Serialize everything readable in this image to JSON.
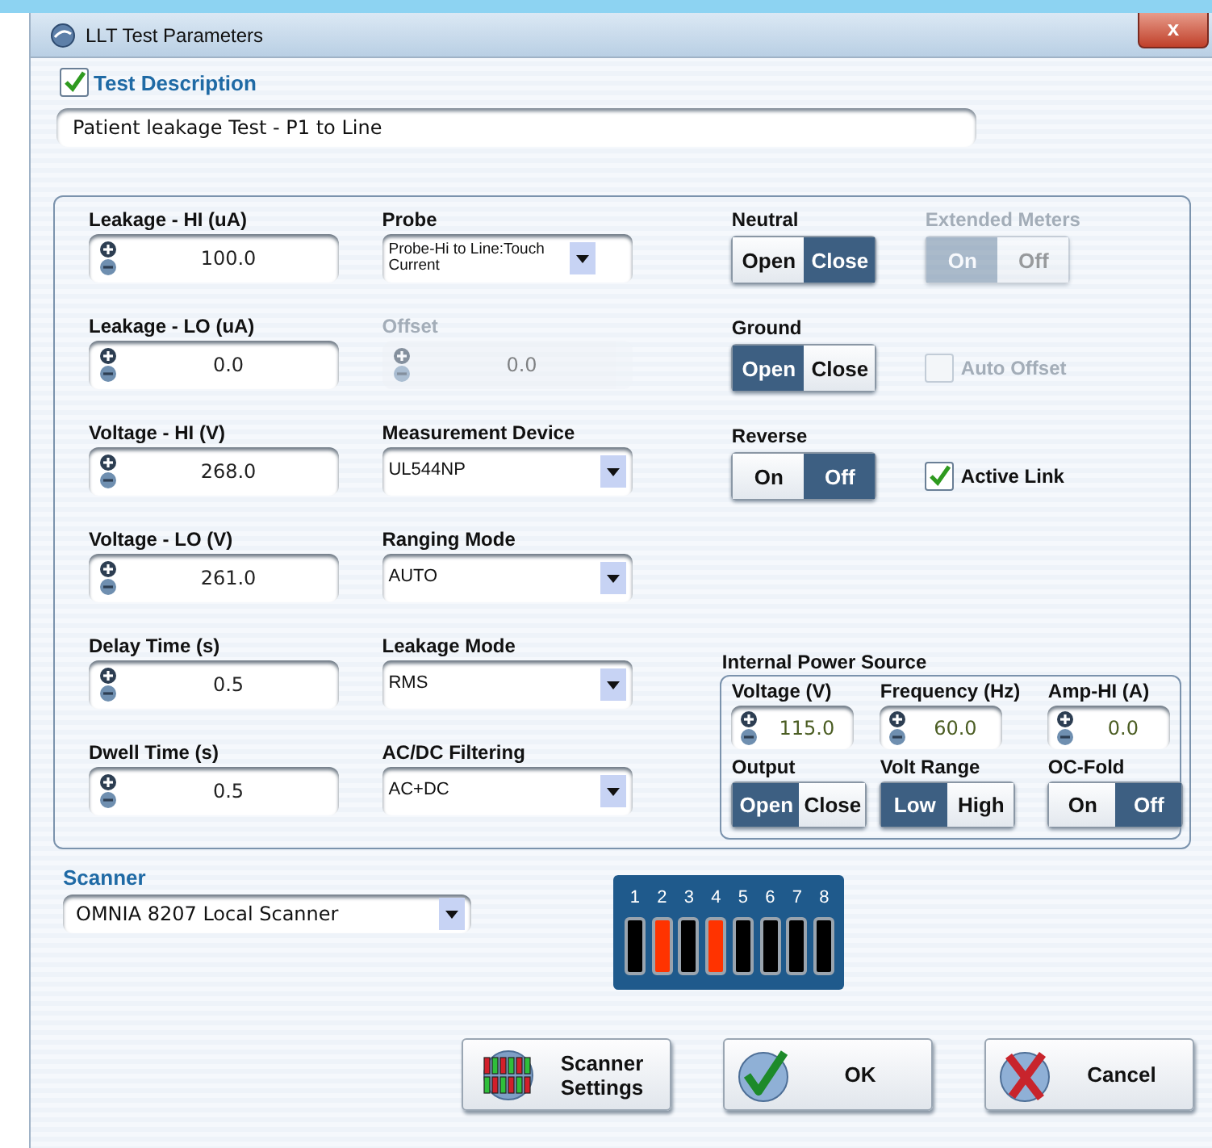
{
  "window": {
    "title": "LLT Test Parameters",
    "close": "x"
  },
  "test_description": {
    "label": "Test Description",
    "checked": true,
    "value": "Patient leakage Test - P1 to Line"
  },
  "left_fields": [
    {
      "kind": "spinner",
      "label": "Leakage - HI (uA)",
      "value": "100.0",
      "disabled": false
    },
    {
      "kind": "spinner",
      "label": "Leakage - LO (uA)",
      "value": "0.0",
      "disabled": false
    },
    {
      "kind": "spinner",
      "label": "Voltage - HI (V)",
      "value": "268.0",
      "disabled": false
    },
    {
      "kind": "spinner",
      "label": "Voltage - LO (V)",
      "value": "261.0",
      "disabled": false
    },
    {
      "kind": "spinner",
      "label": "Delay Time (s)",
      "value": "0.5",
      "disabled": false
    },
    {
      "kind": "spinner",
      "label": "Dwell Time (s)",
      "value": "0.5",
      "disabled": false
    }
  ],
  "middle_fields": [
    {
      "kind": "dropdown",
      "label": "Probe",
      "value": "Probe-Hi to Line:Touch Current",
      "disabled": false
    },
    {
      "kind": "spinner",
      "label": "Offset",
      "value": "0.0",
      "disabled": true
    },
    {
      "kind": "dropdown",
      "label": "Measurement Device",
      "value": "UL544NP",
      "disabled": false
    },
    {
      "kind": "dropdown",
      "label": "Ranging Mode",
      "value": "AUTO",
      "disabled": false
    },
    {
      "kind": "dropdown",
      "label": "Leakage Mode",
      "value": "RMS",
      "disabled": false
    },
    {
      "kind": "dropdown",
      "label": "AC/DC Filtering",
      "value": "AC+DC",
      "disabled": false
    }
  ],
  "right_controls": [
    {
      "kind": "switch",
      "label": "Neutral",
      "disabled": false,
      "options": [
        {
          "label": "Open",
          "selected": false
        },
        {
          "label": "Close",
          "selected": true
        }
      ]
    },
    {
      "kind": "switch",
      "label": "Extended Meters",
      "disabled": true,
      "options": [
        {
          "label": "On",
          "selected": true
        },
        {
          "label": "Off",
          "selected": false
        }
      ]
    },
    {
      "kind": "switch",
      "label": "Ground",
      "disabled": false,
      "options": [
        {
          "label": "Open",
          "selected": true
        },
        {
          "label": "Close",
          "selected": false
        }
      ]
    },
    {
      "kind": "checkbox",
      "label": "Auto Offset",
      "checked": false,
      "disabled": true
    },
    {
      "kind": "switch",
      "label": "Reverse",
      "disabled": false,
      "options": [
        {
          "label": "On",
          "selected": false
        },
        {
          "label": "Off",
          "selected": true
        }
      ]
    },
    {
      "kind": "checkbox",
      "label": "Active Link",
      "checked": true,
      "disabled": false
    }
  ],
  "power_source": {
    "title": "Internal Power Source",
    "fields": [
      {
        "label": "Voltage (V)",
        "value": "115.0"
      },
      {
        "label": "Frequency (Hz)",
        "value": "60.0"
      },
      {
        "label": "Amp-HI (A)",
        "value": "0.0"
      }
    ],
    "switches": [
      {
        "label": "Output",
        "options": [
          {
            "label": "Open",
            "selected": true
          },
          {
            "label": "Close",
            "selected": false
          }
        ]
      },
      {
        "label": "Volt Range",
        "options": [
          {
            "label": "Low",
            "selected": true
          },
          {
            "label": "High",
            "selected": false
          }
        ]
      },
      {
        "label": "OC-Fold",
        "options": [
          {
            "label": "On",
            "selected": false
          },
          {
            "label": "Off",
            "selected": true
          }
        ]
      }
    ]
  },
  "scanner": {
    "label": "Scanner",
    "value": "OMNIA 8207 Local Scanner"
  },
  "channels": [
    {
      "label": "1",
      "active": false
    },
    {
      "label": "2",
      "active": true
    },
    {
      "label": "3",
      "active": false
    },
    {
      "label": "4",
      "active": true
    },
    {
      "label": "5",
      "active": false
    },
    {
      "label": "6",
      "active": false
    },
    {
      "label": "7",
      "active": false
    },
    {
      "label": "8",
      "active": false
    }
  ],
  "buttons": [
    {
      "kind": "scanner",
      "label": "Scanner Settings"
    },
    {
      "kind": "ok",
      "label": "OK"
    },
    {
      "kind": "cancel",
      "label": "Cancel"
    }
  ]
}
